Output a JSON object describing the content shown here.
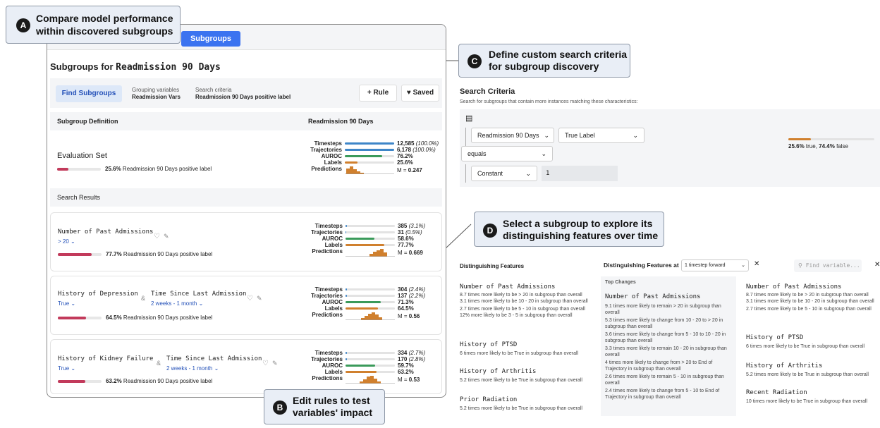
{
  "callouts": {
    "a": {
      "badge": "A",
      "line1": "Compare model performance",
      "line2": "within discovered subgroups"
    },
    "b": {
      "badge": "B",
      "line1": "Edit rules to test",
      "line2": "variables' impact"
    },
    "c": {
      "badge": "C",
      "line1": "Define custom search criteria",
      "line2": "for subgroup discovery"
    },
    "d": {
      "badge": "D",
      "line1": "Select a subgroup to explore its",
      "line2": "distinguishing features over time"
    }
  },
  "app": {
    "tab": "Subgroups",
    "title_prefix": "Subgroups for",
    "title_target": "Readmission 90 Days",
    "find_button": "Find Subgroups",
    "grouping_label": "Grouping variables",
    "grouping_value": "Readmission Vars",
    "criteria_label": "Search criteria",
    "criteria_value": "Readmission 90 Days positive label",
    "rule_button": "+ Rule",
    "saved_button": "♥ Saved",
    "col_def": "Subgroup Definition",
    "col_target": "Readmission 90 Days",
    "eval_title": "Evaluation Set",
    "eval_pct": "25.6%",
    "eval_text": "Readmission 90 Days positive label",
    "search_results": "Search Results",
    "metric_labels": [
      "Timesteps",
      "Trajectories",
      "AUROC",
      "Labels",
      "Predictions"
    ],
    "eval_metrics": {
      "timesteps": "12,585",
      "timesteps_pct": "(100.0%)",
      "trajectories": "6,178",
      "trajectories_pct": "(100.0%)",
      "auroc": "76.2%",
      "labels": "25.6%",
      "pred": "M = ",
      "pred_val": "0.247"
    },
    "results": [
      {
        "v1": "Number of Past Admissions",
        "f1": "> 20",
        "pct": "77.7%",
        "text": "Readmission 90 Days positive label",
        "timesteps": "385",
        "timesteps_pct": "(3.1%)",
        "trajectories": "31",
        "trajectories_pct": "(0.5%)",
        "auroc": "58.6%",
        "labels": "77.7%",
        "pred": "M = ",
        "pred_val": "0.669"
      },
      {
        "v1": "History of Depression",
        "f1": "True",
        "v2": "Time Since Last Admission",
        "f2": "2 weeks - 1 month",
        "pct": "64.5%",
        "text": "Readmission 90 Days positive label",
        "timesteps": "304",
        "timesteps_pct": "(2.4%)",
        "trajectories": "137",
        "trajectories_pct": "(2.2%)",
        "auroc": "71.3%",
        "labels": "64.5%",
        "pred": "M = ",
        "pred_val": "0.56"
      },
      {
        "v1": "History of Kidney Failure",
        "f1": "True",
        "v2": "Time Since Last Admission",
        "f2": "2 weeks - 1 month",
        "pct": "63.2%",
        "text": "Readmission 90 Days positive label",
        "timesteps": "334",
        "timesteps_pct": "(2.7%)",
        "trajectories": "170",
        "trajectories_pct": "(2.8%)",
        "auroc": "59.7%",
        "labels": "63.2%",
        "pred": "M = ",
        "pred_val": "0.53"
      }
    ]
  },
  "criteria": {
    "title": "Search Criteria",
    "subtitle": "Search for subgroups that contain more instances matching these characteristics:",
    "var": "Readmission 90 Days",
    "attr": "True Label",
    "op": "equals",
    "kind": "Constant",
    "value": "1",
    "true_pct": "25.6%",
    "true_txt": "true, ",
    "false_pct": "74.4%",
    "false_txt": "false"
  },
  "features": {
    "title": "Distinguishing Features",
    "at_label": "Distinguishing Features at",
    "step": "1 timestep forward",
    "find_placeholder": "Find variable...",
    "top_changes": "Top Changes",
    "col1": [
      {
        "name": "Number of Past Admissions",
        "lines": [
          "8.7 times more likely to be > 20 in subgroup than overall",
          "3.1 times more likely to be 10 - 20 in subgroup than overall",
          "2.7 times more likely to be 5 - 10 in subgroup than overall",
          "12% more likely to be 3 - 5 in subgroup than overall"
        ]
      },
      {
        "name": "History of PTSD",
        "lines": [
          "6 times more likely to be True in subgroup than overall"
        ]
      },
      {
        "name": "History of Arthritis",
        "lines": [
          "5.2 times more likely to be True in subgroup than overall"
        ]
      },
      {
        "name": "Prior Radiation",
        "lines": [
          "5.2 times more likely to be True in subgroup than overall"
        ]
      }
    ],
    "col2": {
      "name": "Number of Past Admissions",
      "lines": [
        "9.1 times more likely to remain > 20 in subgroup than overall",
        "5.3 times more likely to change from 10 - 20 to > 20 in subgroup than overall",
        "3.6 times more likely to change from 5 - 10 to 10 - 20 in subgroup than overall",
        "3.3 times more likely to remain 10 - 20 in subgroup than overall",
        "4 times more likely to change from > 20 to End of Trajectory in subgroup than overall",
        "2.6 times more likely to remain 5 - 10 in subgroup than overall",
        "2.4 times more likely to change from 5 - 10 to End of Trajectory in subgroup than overall"
      ]
    },
    "col3": [
      {
        "name": "Number of Past Admissions",
        "lines": [
          "8.7 times more likely to be > 20 in subgroup than overall",
          "3.1 times more likely to be 10 - 20 in subgroup than overall",
          "2.7 times more likely to be 5 - 10 in subgroup than overall"
        ]
      },
      {
        "name": "History of PTSD",
        "lines": [
          "6 times more likely to be True in subgroup than overall"
        ]
      },
      {
        "name": "History of Arthritis",
        "lines": [
          "5.2 times more likely to be True in subgroup than overall"
        ]
      },
      {
        "name": "Recent Radiation",
        "lines": [
          "10 times more likely to be True in subgroup than overall"
        ]
      }
    ]
  }
}
